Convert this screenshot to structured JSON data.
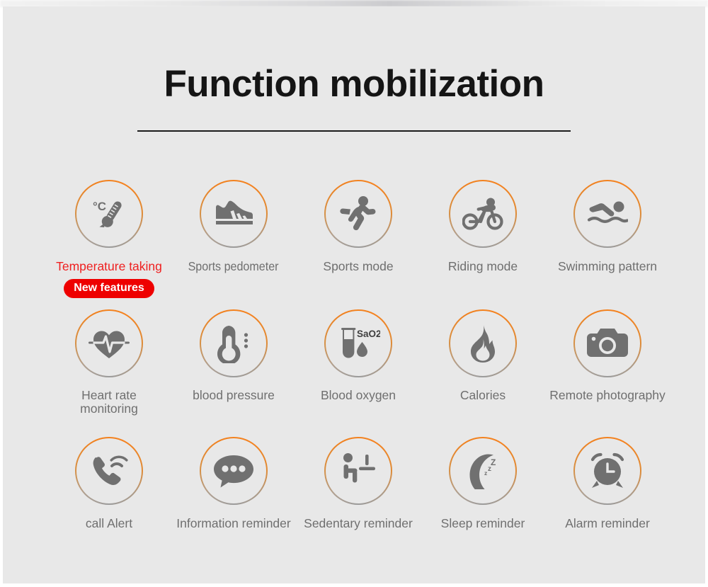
{
  "header": {
    "title": "Function mobilization"
  },
  "theme": {
    "background": "#e8e8e8",
    "page_border": "#ffffff",
    "ring_orange": "#f5821f",
    "ring_gray": "#9b9b9b",
    "icon_gray": "#707070",
    "label_gray": "#6f6f6f",
    "highlight_red": "#ef2020",
    "badge_red": "#ee0000",
    "title_black": "#151515"
  },
  "features": {
    "rows": [
      {
        "items": [
          {
            "label": "Temperature taking",
            "icon": "thermometer-celsius-icon",
            "highlight": true,
            "badge": "New features"
          },
          {
            "label": "Sports pedometer",
            "icon": "sneaker-shoe-icon",
            "highlight": false,
            "badge": null
          },
          {
            "label": "Sports mode",
            "icon": "running-person-icon",
            "highlight": false,
            "badge": null
          },
          {
            "label": "Riding mode",
            "icon": "cyclist-bicycle-icon",
            "highlight": false,
            "badge": null
          },
          {
            "label": "Swimming pattern",
            "icon": "swimmer-icon",
            "highlight": false,
            "badge": null
          }
        ]
      },
      {
        "items": [
          {
            "label": "Heart rate\nmonitoring",
            "icon": "heart-pulse-icon",
            "highlight": false,
            "badge": null
          },
          {
            "label": "blood pressure",
            "icon": "blood-pressure-gauge-icon",
            "highlight": false,
            "badge": null
          },
          {
            "label": "Blood oxygen",
            "icon": "test-tube-sao2-icon",
            "highlight": false,
            "badge": null,
            "icon_text": "SaO2"
          },
          {
            "label": "Calories",
            "icon": "flame-icon",
            "highlight": false,
            "badge": null
          },
          {
            "label": "Remote photography",
            "icon": "camera-icon",
            "highlight": false,
            "badge": null
          }
        ]
      },
      {
        "items": [
          {
            "label": "call  Alert",
            "icon": "phone-ringing-icon",
            "highlight": false,
            "badge": null
          },
          {
            "label": "Information reminder",
            "icon": "chat-bubble-dots-icon",
            "highlight": false,
            "badge": null
          },
          {
            "label": "Sedentary reminder",
            "icon": "sitting-person-desk-icon",
            "highlight": false,
            "badge": null
          },
          {
            "label": "Sleep reminder",
            "icon": "crescent-moon-zzz-icon",
            "highlight": false,
            "badge": null,
            "icon_text": "zzZ"
          },
          {
            "label": "Alarm reminder",
            "icon": "alarm-clock-icon",
            "highlight": false,
            "badge": null
          }
        ]
      }
    ]
  }
}
